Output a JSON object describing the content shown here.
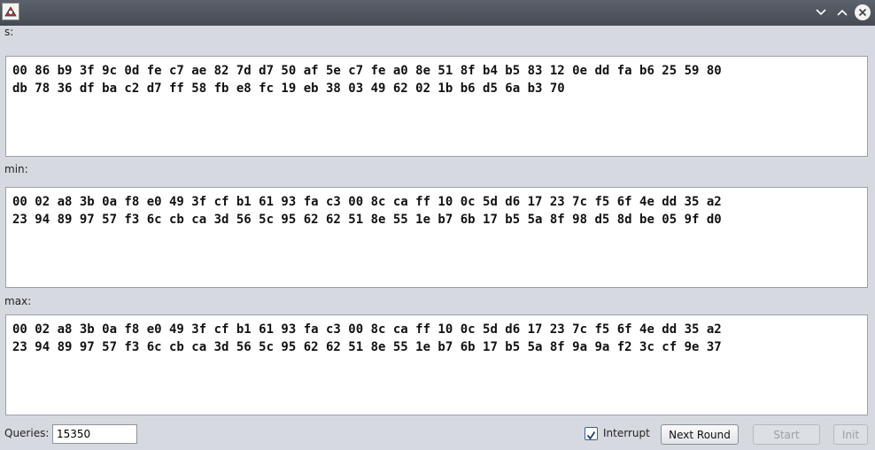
{
  "window": {
    "icons": [
      "app-icon",
      "minimize-icon",
      "maximize-icon",
      "close-icon"
    ]
  },
  "fields": {
    "s": {
      "label": "s:",
      "text": "00 86 b9 3f 9c 0d fe c7 ae 82 7d d7 50 af 5e c7 fe a0 8e 51 8f b4 b5 83 12 0e dd fa b6 25 59 80\ndb 78 36 df ba c2 d7 ff 58 fb e8 fc 19 eb 38 03 49 62 02 1b b6 d5 6a b3 70"
    },
    "min": {
      "label": "min:",
      "text": "00 02 a8 3b 0a f8 e0 49 3f cf b1 61 93 fa c3 00 8c ca ff 10 0c 5d d6 17 23 7c f5 6f 4e dd 35 a2\n23 94 89 97 57 f3 6c cb ca 3d 56 5c 95 62 62 51 8e 55 1e b7 6b 17 b5 5a 8f 98 d5 8d be 05 9f d0"
    },
    "max": {
      "label": "max:",
      "text": "00 02 a8 3b 0a f8 e0 49 3f cf b1 61 93 fa c3 00 8c ca ff 10 0c 5d d6 17 23 7c f5 6f 4e dd 35 a2\n23 94 89 97 57 f3 6c cb ca 3d 56 5c 95 62 62 51 8e 55 1e b7 6b 17 b5 5a 8f 9a 9a f2 3c cf 9e 37"
    }
  },
  "footer": {
    "queries_label": "Queries:",
    "queries_value": "15350",
    "interrupt_label": "Interrupt",
    "interrupt_checked": true,
    "next_round_label": "Next Round",
    "start_label": "Start",
    "init_label": "Init"
  }
}
